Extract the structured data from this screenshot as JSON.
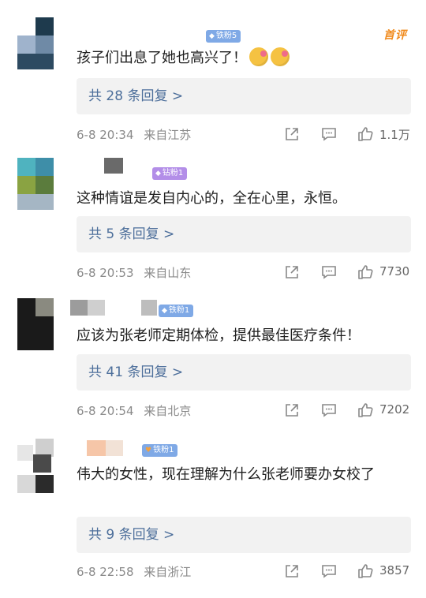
{
  "top_logo": "首评",
  "comments": [
    {
      "badge": "铁粉5",
      "text": "孩子们出息了她也高兴了！",
      "emoji_count": 2,
      "replies": "共 28 条回复 >",
      "time": "6-8 20:34",
      "location": "来自江苏",
      "likes": "1.1万"
    },
    {
      "badge": "钻粉1",
      "text": "这种情谊是发自内心的，全在心里，永恒。",
      "replies": "共 5 条回复 >",
      "time": "6-8 20:53",
      "location": "来自山东",
      "likes": "7730"
    },
    {
      "badge": "铁粉1",
      "text": "应该为张老师定期体检，提供最佳医疗条件！",
      "replies": "共 41 条回复 >",
      "time": "6-8 20:54",
      "location": "来自北京",
      "likes": "7202"
    },
    {
      "badge": "铁粉1",
      "text": "伟大的女性，现在理解为什么张老师要办女校了",
      "replies": "共 9 条回复 >",
      "time": "6-8 22:58",
      "location": "来自浙江",
      "likes": "3857"
    }
  ]
}
